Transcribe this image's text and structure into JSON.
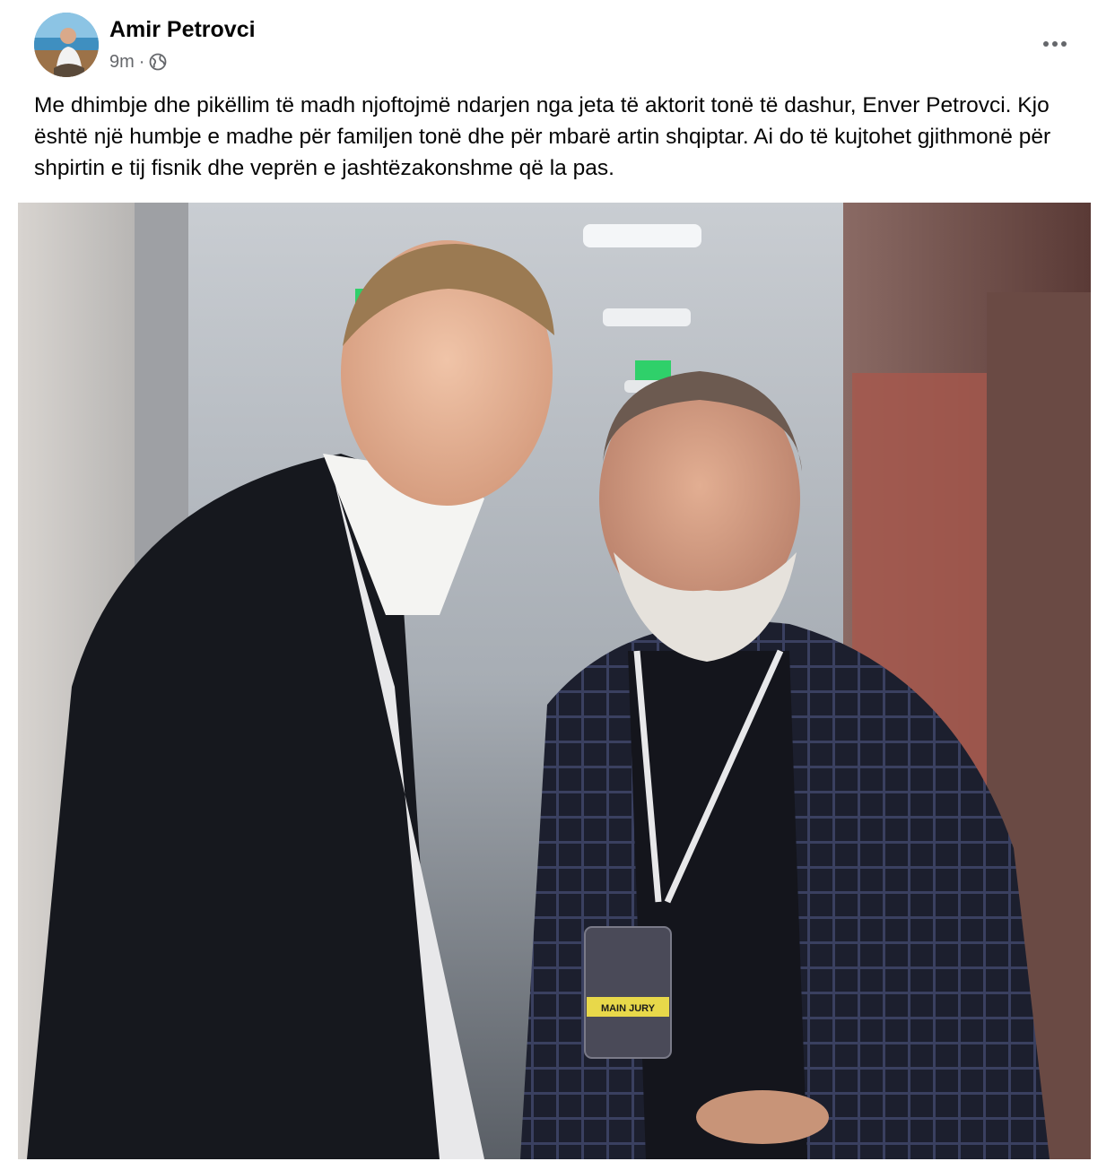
{
  "post": {
    "author": "Amir Petrovci",
    "time": "9m",
    "separator": "·",
    "privacy_icon": "globe-icon",
    "more_icon": "more-options-icon",
    "text": "Me dhimbje dhe pikëllim të madh njoftojmë ndarjen nga jeta të aktorit tonë të dashur, Enver Petrovci. Kjo është një humbje e madhe për familjen tonë dhe për mbarë artin shqiptar. Ai do të kujtohet gjithmonë për shpirtin e tij fisnik dhe veprën e jashtëzakonshme që la pas.",
    "photo": {
      "badge_text": "MAIN JURY"
    }
  },
  "colors": {
    "text_primary": "#050505",
    "text_secondary": "#65676b",
    "background": "#ffffff",
    "badge_yellow": "#e8d84a"
  }
}
